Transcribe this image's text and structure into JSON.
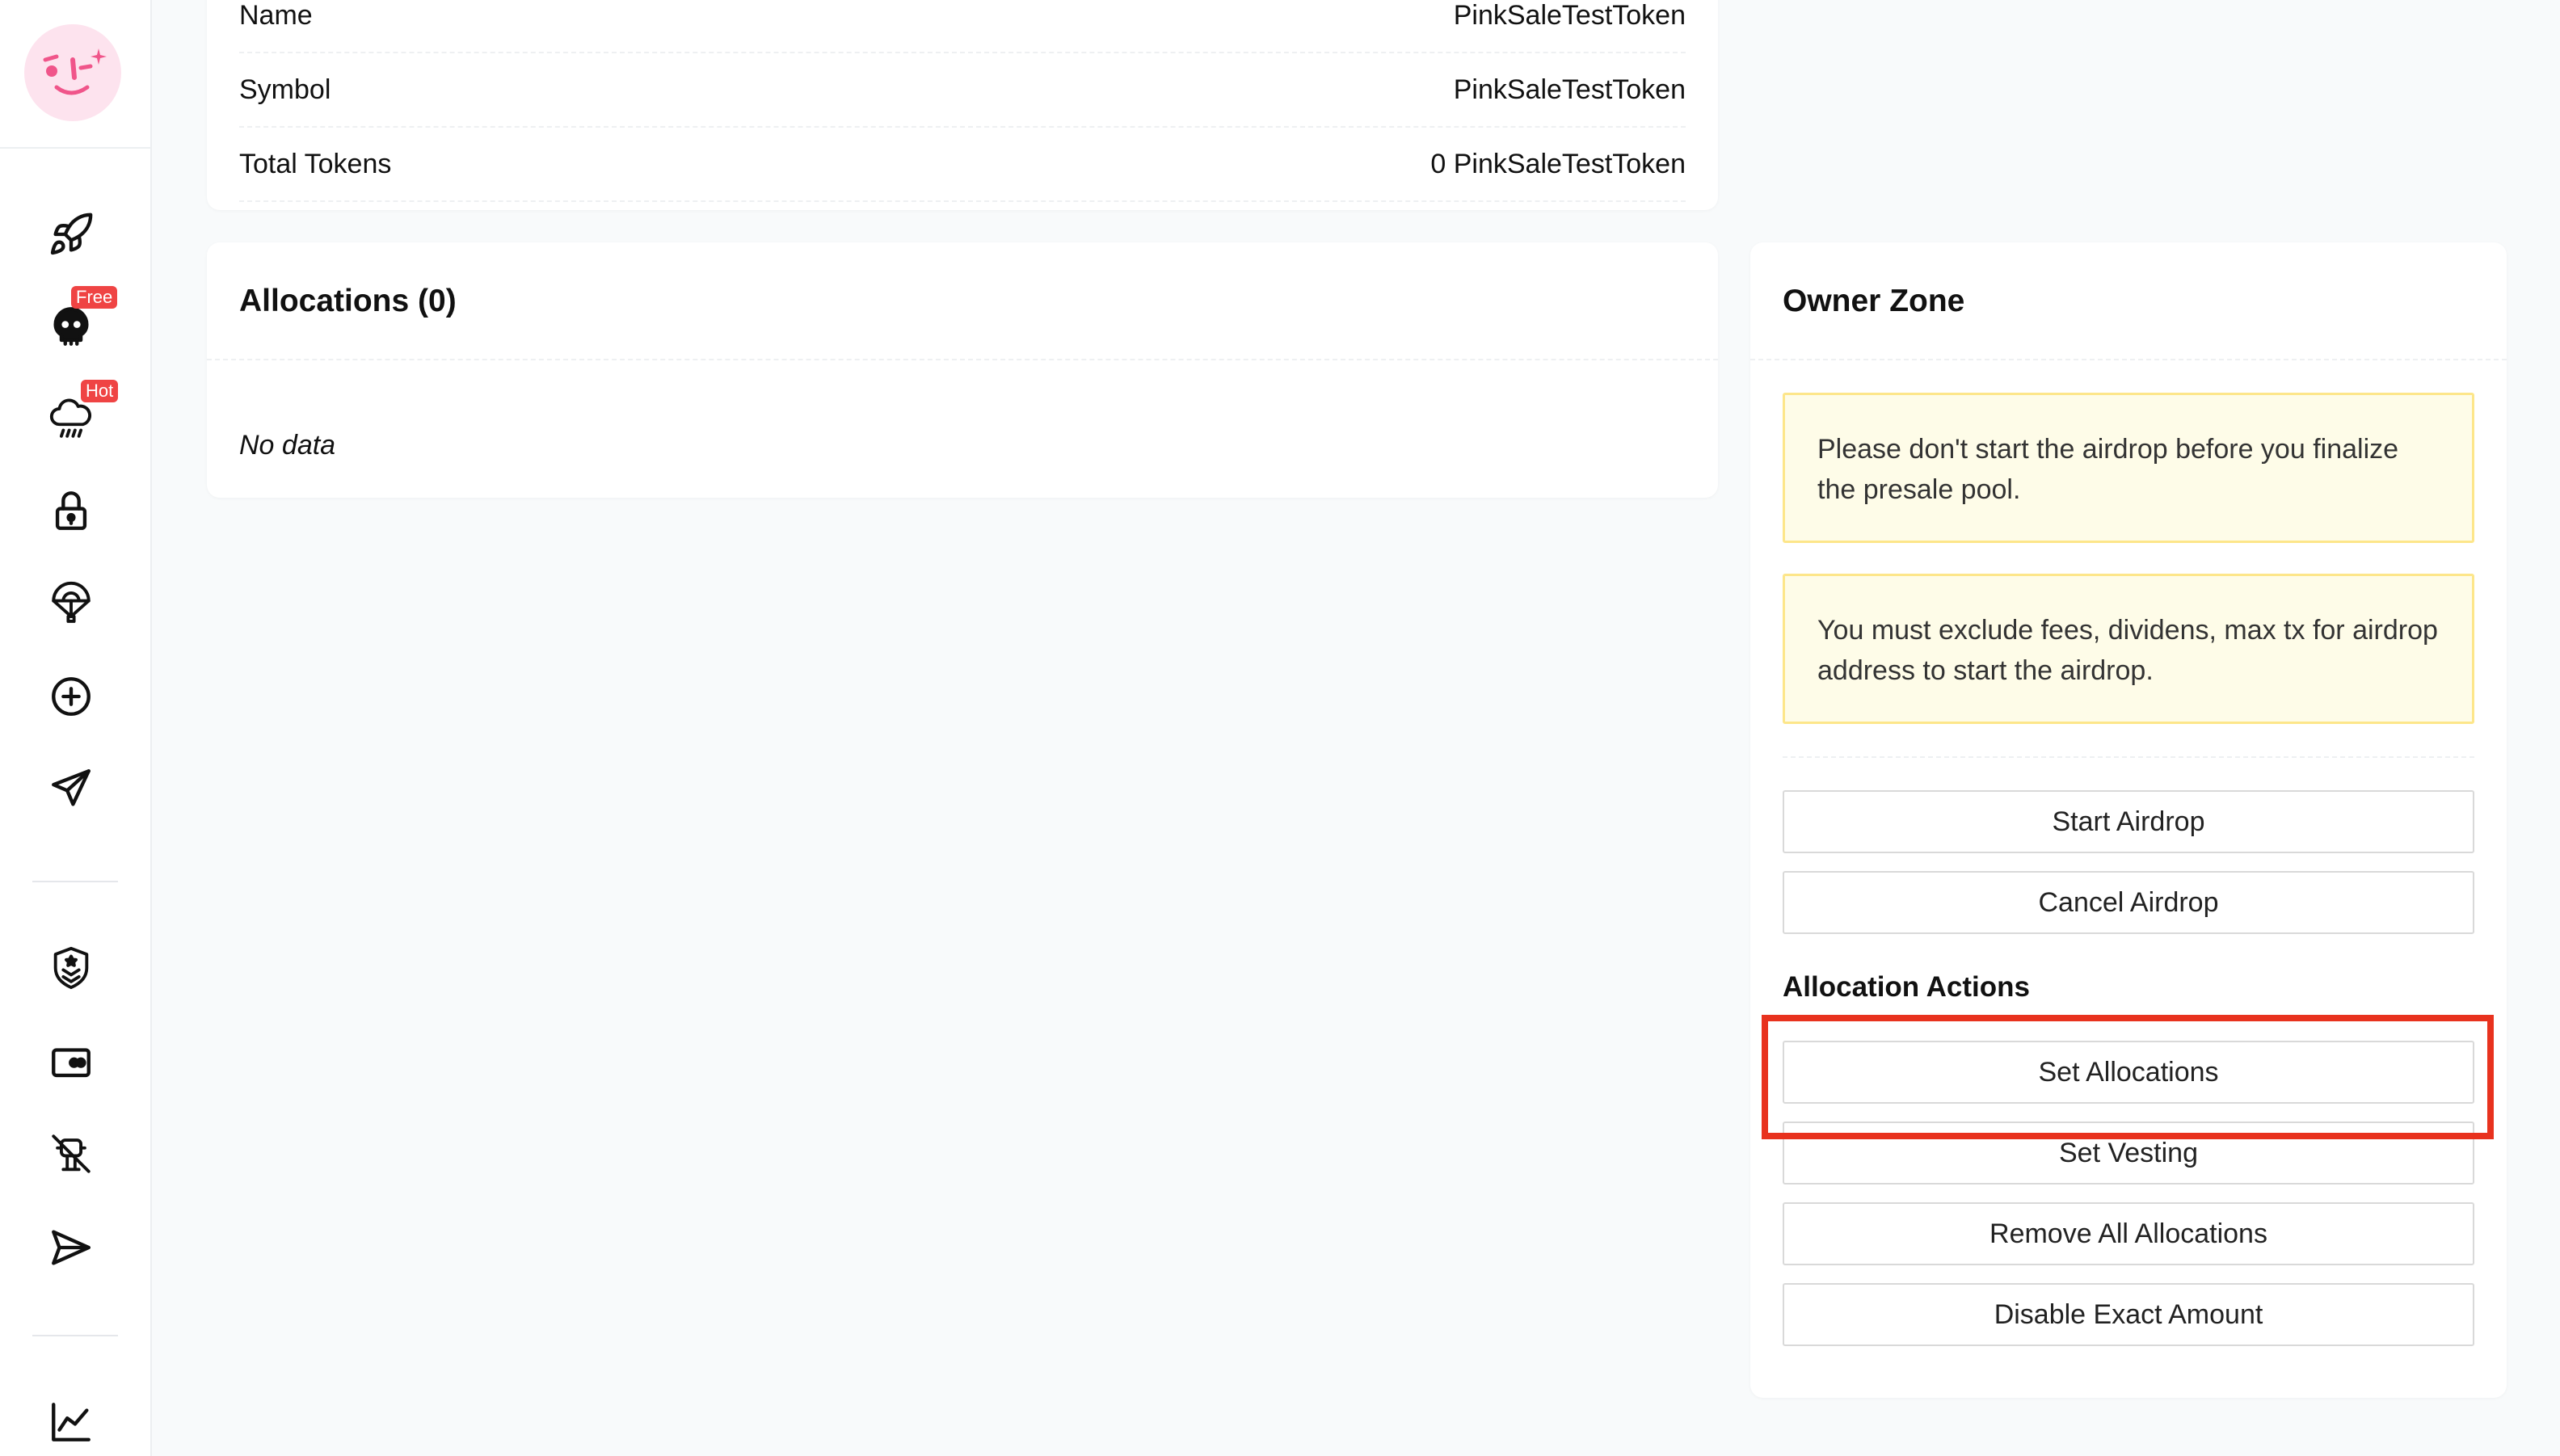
{
  "sidebar": {
    "badges": {
      "free": "Free",
      "hot": "Hot"
    },
    "icons": [
      "rocket-icon",
      "skull-icon",
      "rain-cloud-icon",
      "lock-icon",
      "parachute-icon",
      "plus-circle-icon",
      "send-plane-icon",
      "shield-badge-icon",
      "id-card-icon",
      "no-robot-icon",
      "send-arrow-icon",
      "line-chart-icon"
    ]
  },
  "token_info": {
    "rows": [
      {
        "label": "Name",
        "value": "PinkSaleTestToken"
      },
      {
        "label": "Symbol",
        "value": "PinkSaleTestToken"
      },
      {
        "label": "Total Tokens",
        "value": "0 PinkSaleTestToken"
      }
    ]
  },
  "allocations": {
    "title": "Allocations (0)",
    "empty_text": "No data"
  },
  "owner_zone": {
    "title": "Owner Zone",
    "alert_1": "Please don't start the airdrop before you finalize the presale pool.",
    "alert_2": "You must exclude fees, dividens, max tx for airdrop address to start the airdrop.",
    "start_airdrop": "Start Airdrop",
    "cancel_airdrop": "Cancel Airdrop",
    "allocation_actions_title": "Allocation Actions",
    "set_allocations": "Set Allocations",
    "set_vesting": "Set Vesting",
    "remove_all_allocations": "Remove All Allocations",
    "disable_exact_amount": "Disable Exact Amount"
  },
  "colors": {
    "accent_highlight": "#e8321e",
    "alert_bg": "#fefce8",
    "alert_border": "#fde68a",
    "badge": "#ef4444",
    "logo_pink": "#f0558a"
  }
}
